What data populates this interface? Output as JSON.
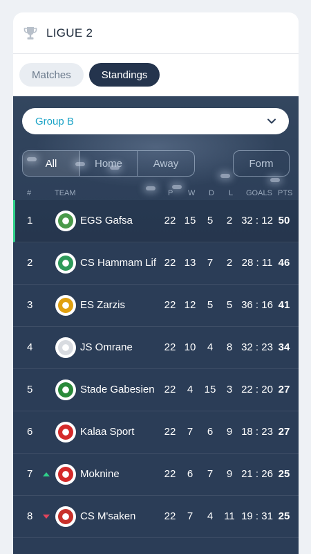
{
  "header": {
    "league": "LIGUE 2",
    "icon": "trophy-icon"
  },
  "tabs": [
    {
      "label": "Matches",
      "active": false
    },
    {
      "label": "Standings",
      "active": true
    }
  ],
  "group_select": {
    "value": "Group B"
  },
  "filters": {
    "options": [
      "All",
      "Home",
      "Away"
    ],
    "selected": "All",
    "form_label": "Form"
  },
  "columns": {
    "pos": "#",
    "team": "TEAM",
    "p": "P",
    "w": "W",
    "d": "D",
    "l": "L",
    "goals": "GOALS",
    "pts": "PTS"
  },
  "rows": [
    {
      "pos": "1",
      "team": "EGS Gafsa",
      "p": "22",
      "w": "15",
      "d": "5",
      "l": "2",
      "goals": "32 : 12",
      "pts": "50",
      "trend": "",
      "logo_color": "#4a9a4a"
    },
    {
      "pos": "2",
      "team": "CS Hammam Lif",
      "p": "22",
      "w": "13",
      "d": "7",
      "l": "2",
      "goals": "28 : 11",
      "pts": "46",
      "trend": "",
      "logo_color": "#2e9a5a"
    },
    {
      "pos": "3",
      "team": "ES Zarzis",
      "p": "22",
      "w": "12",
      "d": "5",
      "l": "5",
      "goals": "36 : 16",
      "pts": "41",
      "trend": "",
      "logo_color": "#e0a010"
    },
    {
      "pos": "4",
      "team": "JS Omrane",
      "p": "22",
      "w": "10",
      "d": "4",
      "l": "8",
      "goals": "32 : 23",
      "pts": "34",
      "trend": "",
      "logo_color": "#d8dbe0"
    },
    {
      "pos": "5",
      "team": "Stade Gabesien",
      "p": "22",
      "w": "4",
      "d": "15",
      "l": "3",
      "goals": "22 : 20",
      "pts": "27",
      "trend": "",
      "logo_color": "#2a8a3a"
    },
    {
      "pos": "6",
      "team": "Kalaa Sport",
      "p": "22",
      "w": "7",
      "d": "6",
      "l": "9",
      "goals": "18 : 23",
      "pts": "27",
      "trend": "",
      "logo_color": "#d42a2a"
    },
    {
      "pos": "7",
      "team": "Moknine",
      "p": "22",
      "w": "6",
      "d": "7",
      "l": "9",
      "goals": "21 : 26",
      "pts": "25",
      "trend": "up",
      "logo_color": "#d42a2a"
    },
    {
      "pos": "8",
      "team": "CS M'saken",
      "p": "22",
      "w": "7",
      "d": "4",
      "l": "11",
      "goals": "19 : 31",
      "pts": "25",
      "trend": "down",
      "logo_color": "#c8302a"
    }
  ]
}
